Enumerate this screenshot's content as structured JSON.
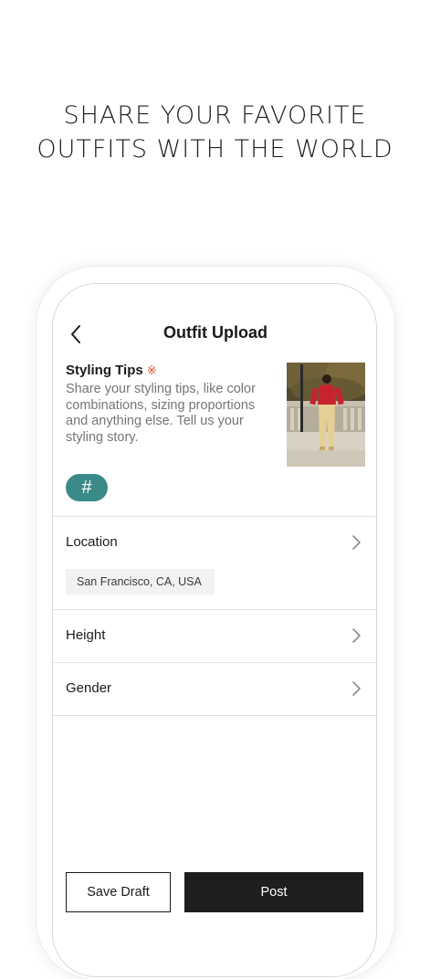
{
  "headline": {
    "line1": "SHARE YOUR FAVORITE",
    "line2": "OUTFITS WITH THE WORLD"
  },
  "screen": {
    "title": "Outfit Upload",
    "styling_tips": {
      "label": "Styling Tips",
      "required_mark": "※",
      "placeholder": "Share your styling tips, like color combinations, sizing proportions and anything else. Tell us your styling story."
    },
    "hashtag_button": {
      "label": "#"
    },
    "rows": {
      "location": {
        "label": "Location",
        "value": "San Francisco, CA, USA"
      },
      "height": {
        "label": "Height"
      },
      "gender": {
        "label": "Gender"
      }
    },
    "actions": {
      "save_draft": "Save Draft",
      "post": "Post"
    }
  },
  "colors": {
    "accent": "#3b8a8a",
    "required": "#d9532a",
    "primary_button": "#1e1e1e"
  },
  "icons": {
    "back": "chevron-left-icon",
    "row_arrow": "chevron-right-icon"
  }
}
